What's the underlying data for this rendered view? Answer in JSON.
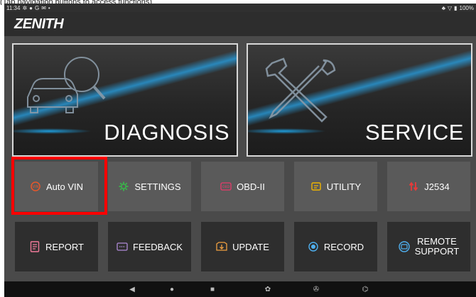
{
  "instruction_text": "(Tap navigation buttons to access functions)",
  "status_bar": {
    "time": "11:34",
    "notification_icons": [
      "gear-icon",
      "circle-icon",
      "g-icon",
      "message-icon",
      "dot-icon"
    ],
    "battery": "100%"
  },
  "app": {
    "logo": "ZENITH"
  },
  "hero_tiles": [
    {
      "label": "DIAGNOSIS"
    },
    {
      "label": "SERVICE"
    }
  ],
  "row1": [
    {
      "label": "Auto VIN",
      "icon": "vin-icon",
      "icon_color": "#e8572a"
    },
    {
      "label": "SETTINGS",
      "icon": "gear-icon",
      "icon_color": "#39b54a"
    },
    {
      "label": "OBD-II",
      "icon": "obd-icon",
      "icon_color": "#e83a6a"
    },
    {
      "label": "UTILITY",
      "icon": "utility-icon",
      "icon_color": "#f0b400"
    },
    {
      "label": "J2534",
      "icon": "j2534-icon",
      "icon_color": "#e83a3a"
    }
  ],
  "row2": [
    {
      "label": "REPORT",
      "icon": "report-icon",
      "icon_color": "#f07a9a"
    },
    {
      "label": "FEEDBACK",
      "icon": "feedback-icon",
      "icon_color": "#b08ad8"
    },
    {
      "label": "UPDATE",
      "icon": "update-icon",
      "icon_color": "#f0a040"
    },
    {
      "label": "RECORD",
      "icon": "record-icon",
      "icon_color": "#4fb0f0"
    },
    {
      "label_line1": "REMOTE",
      "label_line2": "SUPPORT",
      "icon": "remote-support-icon",
      "icon_color": "#4fb0f0"
    }
  ],
  "nav_bar": [
    "back-icon",
    "home-icon",
    "recents-icon",
    "settings-icon",
    "assistant-icon",
    "screenshot-icon"
  ],
  "colors": {
    "highlight": "#ff0000",
    "hero_accent": "#2896d2"
  }
}
